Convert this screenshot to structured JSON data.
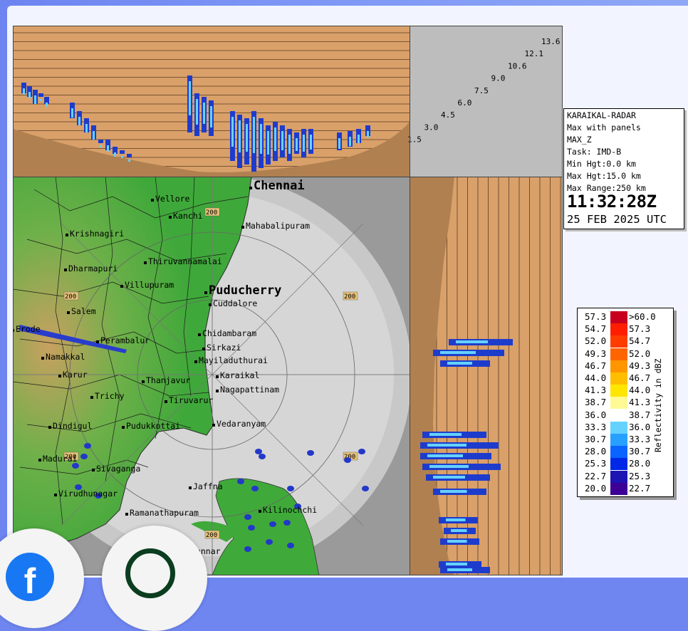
{
  "radar_station": "KARAIKAL-RADAR",
  "product_line1": "Max with panels",
  "product_line2": "MAX_Z",
  "task": "Task: IMD-B",
  "min_height": "Min Hgt:0.0 km",
  "max_height": "Max Hgt:15.0 km",
  "max_range": "Max Range:250 km",
  "time": "11:32:28Z",
  "date": "25 FEB 2025 UTC",
  "height_scale": [
    "13.6",
    "12.1",
    "10.6",
    "9.0",
    "7.5",
    "6.0",
    "4.5",
    "3.0",
    "1.5"
  ],
  "range_ring_label": "200",
  "places": [
    {
      "name": "Chennai",
      "big": true
    },
    {
      "name": "Mahabalipuram"
    },
    {
      "name": "Vellore"
    },
    {
      "name": "Kanchi"
    },
    {
      "name": "Krishnagiri"
    },
    {
      "name": "Thiruvannamalai"
    },
    {
      "name": "Dharmapuri"
    },
    {
      "name": "Villupuram"
    },
    {
      "name": "Puducherry",
      "big": true
    },
    {
      "name": "Cuddalore"
    },
    {
      "name": "Salem"
    },
    {
      "name": "Erode"
    },
    {
      "name": "Perambalur"
    },
    {
      "name": "Chidambaram"
    },
    {
      "name": "Sirkazi"
    },
    {
      "name": "Namakkal"
    },
    {
      "name": "Mayiladuthurai"
    },
    {
      "name": "Karaikal"
    },
    {
      "name": "Karur"
    },
    {
      "name": "Thanjavur"
    },
    {
      "name": "Nagapattinam"
    },
    {
      "name": "Trichy"
    },
    {
      "name": "Tiruvarur"
    },
    {
      "name": "Dindigul"
    },
    {
      "name": "Pudukkottai"
    },
    {
      "name": "Vedaranyam"
    },
    {
      "name": "Madurai"
    },
    {
      "name": "Sivaganga"
    },
    {
      "name": "Jaffna"
    },
    {
      "name": "Virudhunagar"
    },
    {
      "name": "Kilinochchi"
    },
    {
      "name": "Ramanathapuram"
    },
    {
      "name": "Mannar"
    }
  ],
  "legend": {
    "title": "Reflectivity in dBZ",
    "rows": [
      {
        "low": "57.3",
        "high": ">60.0",
        "color": "#c8001e"
      },
      {
        "low": "54.7",
        "high": "57.3",
        "color": "#ff1e00"
      },
      {
        "low": "52.0",
        "high": "54.7",
        "color": "#ff3c00"
      },
      {
        "low": "49.3",
        "high": "52.0",
        "color": "#ff6400"
      },
      {
        "low": "46.7",
        "high": "49.3",
        "color": "#ff9600"
      },
      {
        "low": "44.0",
        "high": "46.7",
        "color": "#ffbe00"
      },
      {
        "low": "41.3",
        "high": "44.0",
        "color": "#ffe600"
      },
      {
        "low": "38.7",
        "high": "41.3",
        "color": "#fffa96"
      },
      {
        "low": "36.0",
        "high": "38.7",
        "color": "#ffffff"
      },
      {
        "low": "33.3",
        "high": "36.0",
        "color": "#64d2ff"
      },
      {
        "low": "30.7",
        "high": "33.3",
        "color": "#28a0ff"
      },
      {
        "low": "28.0",
        "high": "30.7",
        "color": "#0a64ff"
      },
      {
        "low": "25.3",
        "high": "28.0",
        "color": "#0028e6"
      },
      {
        "low": "22.7",
        "high": "25.3",
        "color": "#1e14b4"
      },
      {
        "low": "20.0",
        "high": "22.7",
        "color": "#3c0096"
      }
    ]
  }
}
